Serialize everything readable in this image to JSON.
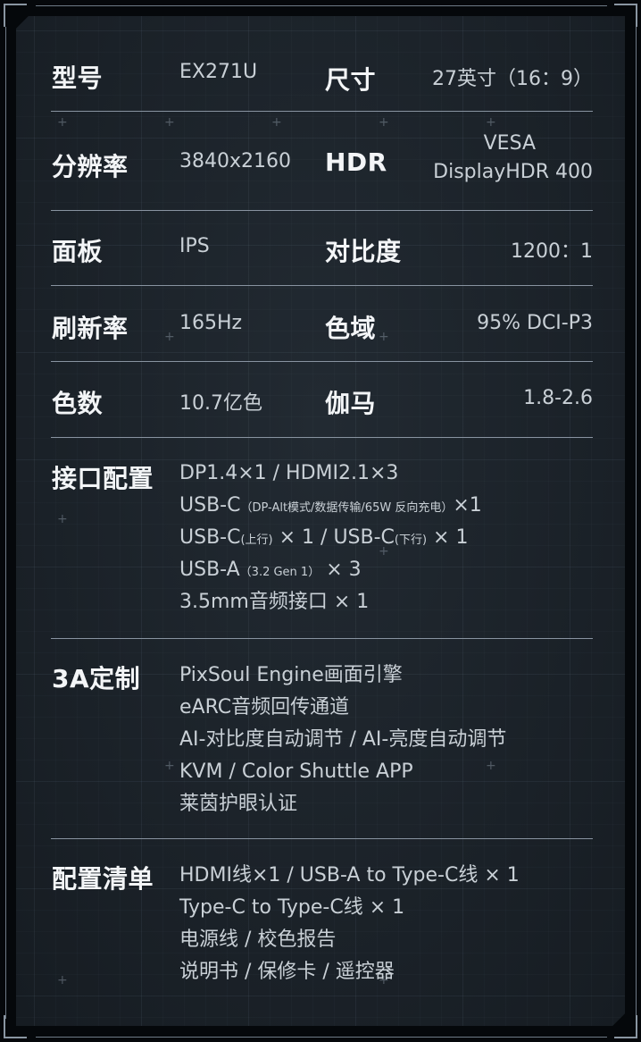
{
  "specs": {
    "model": {
      "label": "型号",
      "value": "EX271U"
    },
    "size": {
      "label": "尺寸",
      "value": "27英寸（16：9）"
    },
    "resolution": {
      "label": "分辨率",
      "value": "3840x2160"
    },
    "hdr": {
      "label": "HDR",
      "value_line1": "VESA",
      "value_line2": "DisplayHDR 400"
    },
    "panel": {
      "label": "面板",
      "value": "IPS"
    },
    "contrast": {
      "label": "对比度",
      "value": "1200：1"
    },
    "refresh": {
      "label": "刷新率",
      "value": "165Hz"
    },
    "gamut": {
      "label": "色域",
      "value": "95% DCI-P3"
    },
    "colors": {
      "label": "色数",
      "value": "10.7亿色"
    },
    "gamma": {
      "label": "伽马",
      "value": "1.8-2.6"
    }
  },
  "ports": {
    "label": "接口配置",
    "line1": "DP1.4×1 / HDMI2.1×3",
    "line2_main": "USB-C",
    "line2_note": "（DP-Alt模式/数据传输/65W 反向充电）",
    "line2_tail": "×1",
    "line3_a": "USB-C",
    "line3_a_note": "(上行)",
    "line3_mid": " × 1 / USB-C",
    "line3_b_note": "(下行)",
    "line3_tail": " × 1",
    "line4_main": "USB-A",
    "line4_note": "（3.2 Gen 1）",
    "line4_tail": " × 3",
    "line5": "3.5mm音频接口 × 1"
  },
  "custom": {
    "label": "3A定制",
    "lines": [
      "PixSoul Engine画面引擎",
      "eARC音频回传通道",
      "AI-对比度自动调节 / AI-亮度自动调节",
      "KVM / Color Shuttle APP",
      "莱茵护眼认证"
    ]
  },
  "package": {
    "label": "配置清单",
    "lines": [
      "HDMI线×1 / USB-A to Type-C线 × 1",
      "Type-C to Type-C线 × 1",
      "电源线 / 校色报告",
      "说明书 / 保修卡 / 遥控器"
    ]
  }
}
